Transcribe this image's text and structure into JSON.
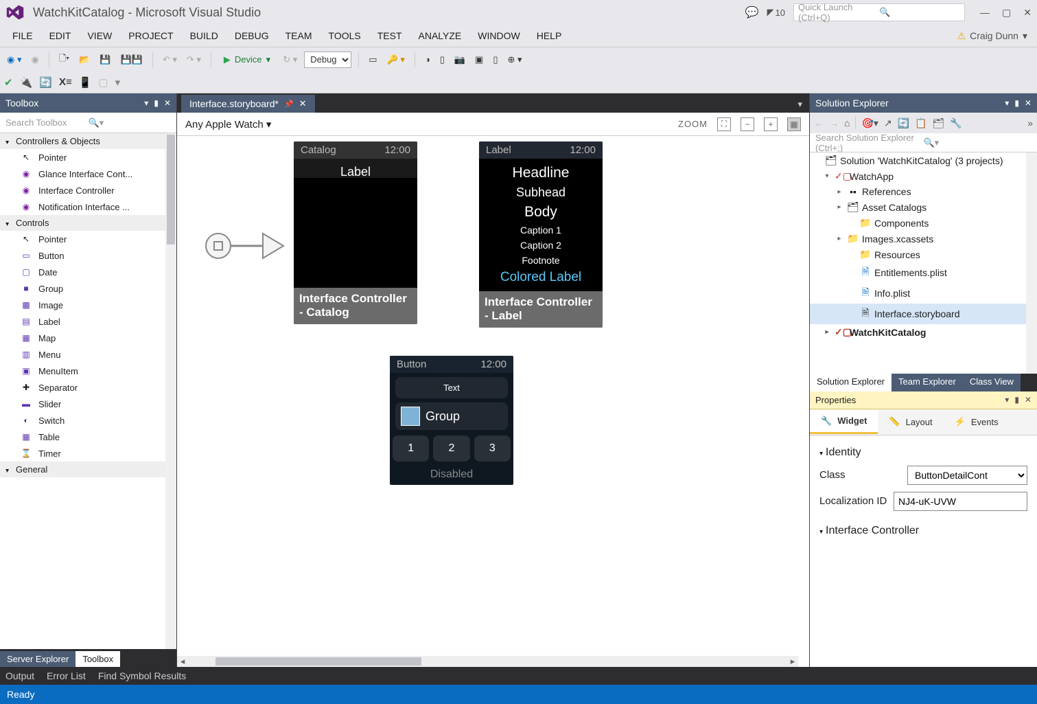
{
  "titlebar": {
    "app_title": "WatchKitCatalog - Microsoft Visual Studio",
    "notification_count": "10",
    "quick_launch_placeholder": "Quick Launch (Ctrl+Q)"
  },
  "menubar": {
    "items": [
      "FILE",
      "EDIT",
      "VIEW",
      "PROJECT",
      "BUILD",
      "DEBUG",
      "TEAM",
      "TOOLS",
      "TEST",
      "ANALYZE",
      "WINDOW",
      "HELP"
    ],
    "user": "Craig Dunn"
  },
  "toolbar": {
    "start_label": "Device",
    "config": "Debug"
  },
  "toolbox": {
    "title": "Toolbox",
    "search_placeholder": "Search Toolbox",
    "cat1": "Controllers & Objects",
    "cat1_items": [
      "Pointer",
      "Glance Interface Cont...",
      "Interface Controller",
      "Notification Interface ..."
    ],
    "cat2": "Controls",
    "cat2_items": [
      "Pointer",
      "Button",
      "Date",
      "Group",
      "Image",
      "Label",
      "Map",
      "Menu",
      "MenuItem",
      "Separator",
      "Slider",
      "Switch",
      "Table",
      "Timer"
    ],
    "cat3": "General",
    "bottom_tabs": [
      "Server Explorer",
      "Toolbox"
    ]
  },
  "designer": {
    "doc_tab": "Interface.storyboard*",
    "device_picker": "Any Apple Watch",
    "zoom_label": "ZOOM",
    "watch1": {
      "left": "Catalog",
      "time": "12:00",
      "body": "Label",
      "footer": "Interface Controller - Catalog"
    },
    "watch2": {
      "left": "Label",
      "time": "12:00",
      "lines": [
        "Headline",
        "Subhead",
        "Body",
        "Caption 1",
        "Caption 2",
        "Footnote"
      ],
      "colored": "Colored Label",
      "footer": "Interface Controller - Label"
    },
    "watch3": {
      "left": "Button",
      "time": "12:00",
      "text": "Text",
      "group": "Group",
      "nums": [
        "1",
        "2",
        "3"
      ],
      "disabled": "Disabled"
    }
  },
  "solution_explorer": {
    "title": "Solution Explorer",
    "search_placeholder": "Search Solution Explorer (Ctrl+;)",
    "root": "Solution 'WatchKitCatalog' (3 projects)",
    "proj1": "WatchApp",
    "proj1_nodes": [
      "References",
      "Asset Catalogs",
      "Components",
      "Images.xcassets",
      "Resources",
      "Entitlements.plist",
      "Info.plist",
      "Interface.storyboard"
    ],
    "proj2": "WatchKitCatalog",
    "bottom_tabs": [
      "Solution Explorer",
      "Team Explorer",
      "Class View"
    ]
  },
  "properties": {
    "title": "Properties",
    "tabs": [
      "Widget",
      "Layout",
      "Events"
    ],
    "section1": "Identity",
    "class_label": "Class",
    "class_value": "ButtonDetailCont",
    "locid_label": "Localization ID",
    "locid_value": "NJ4-uK-UVW",
    "section2": "Interface Controller"
  },
  "bottom": {
    "tabs": [
      "Output",
      "Error List",
      "Find Symbol Results"
    ]
  },
  "status": {
    "text": "Ready"
  }
}
